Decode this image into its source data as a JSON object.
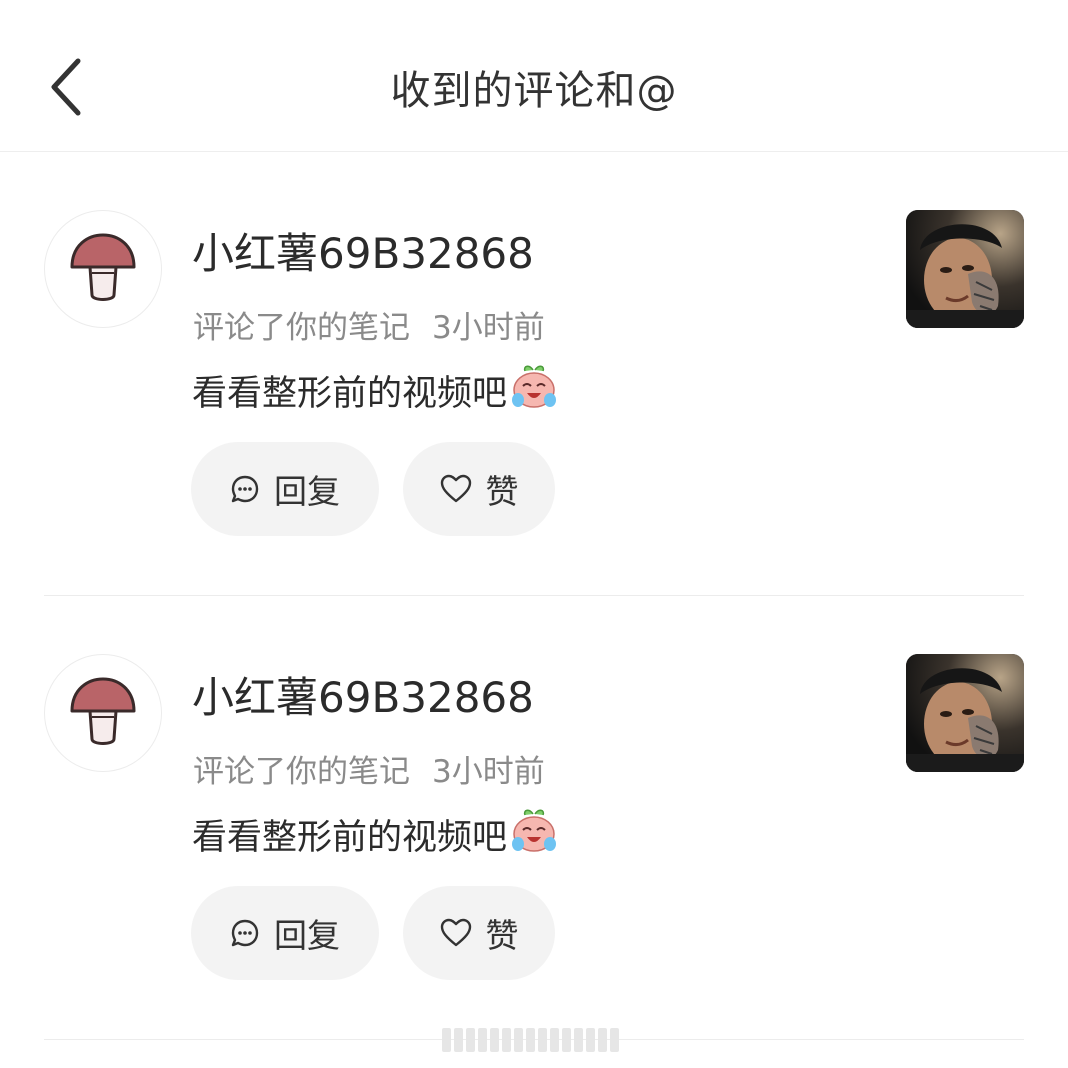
{
  "header": {
    "title": "收到的评论和@",
    "back_icon": "chevron-left-icon"
  },
  "colors": {
    "mushroom_cap": "#b96468",
    "pill_bg": "#f3f3f3",
    "meta_text": "#8a8a8a",
    "divider": "#ececec"
  },
  "comments": [
    {
      "username": "小红薯69B32868",
      "action": "评论了你的笔记",
      "time": "3小时前",
      "text": "看看整形前的视频吧",
      "emoji": "crying-laughing-peach-emoji",
      "avatar_icon": "mushroom-avatar-icon",
      "reply_label": "回复",
      "like_label": "赞"
    },
    {
      "username": "小红薯69B32868",
      "action": "评论了你的笔记",
      "time": "3小时前",
      "text": "看看整形前的视频吧",
      "emoji": "crying-laughing-peach-emoji",
      "avatar_icon": "mushroom-avatar-icon",
      "reply_label": "回复",
      "like_label": "赞"
    }
  ]
}
